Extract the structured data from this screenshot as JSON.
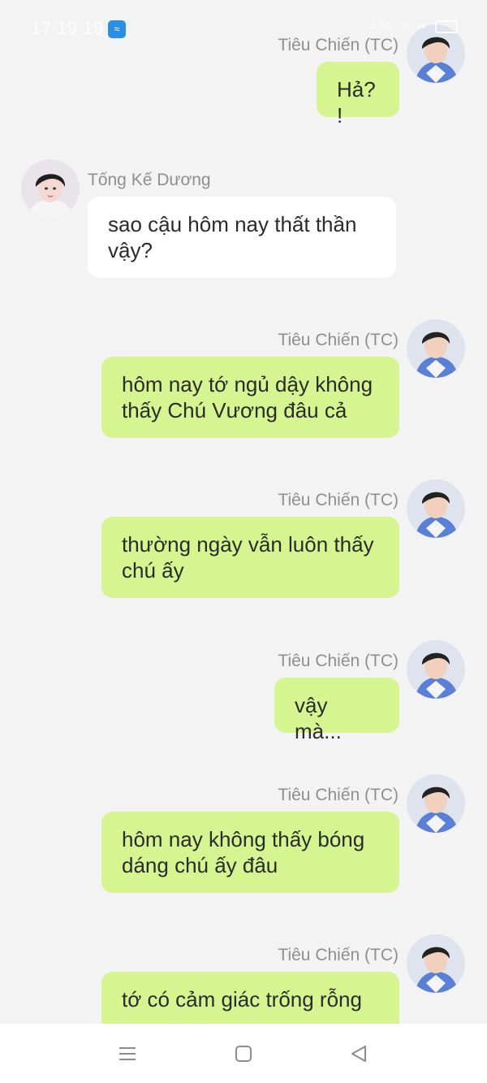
{
  "status_bar": {
    "time": "17:19:19",
    "app_icon": "wifi-hotspot-icon",
    "speed": "4.00",
    "signal": "signal-icon",
    "battery": "battery-icon"
  },
  "colors": {
    "background": "#f3f3f3",
    "outgoing_bubble": "#d4f58f",
    "incoming_bubble": "#ffffff",
    "name_text": "#8f8f8f",
    "message_text": "#2b2b2b"
  },
  "messages": [
    {
      "side": "right",
      "sender": "Tiêu Chiến (TC)",
      "text": "Hả?!"
    },
    {
      "side": "left",
      "sender": "Tống Kế Dương",
      "text": "sao cậu hôm nay thất thần vậy?"
    },
    {
      "side": "right",
      "sender": "Tiêu Chiến (TC)",
      "text": "hôm nay tớ ngủ dậy không thấy Chú Vương đâu cả"
    },
    {
      "side": "right",
      "sender": "Tiêu Chiến (TC)",
      "text": "thường ngày vẫn luôn thấy chú ấy"
    },
    {
      "side": "right",
      "sender": "Tiêu Chiến (TC)",
      "text": "vậy mà..."
    },
    {
      "side": "right",
      "sender": "Tiêu Chiến (TC)",
      "text": "hôm nay không thấy bóng dáng chú ấy đâu"
    },
    {
      "side": "right",
      "sender": "Tiêu Chiến (TC)",
      "text": "tớ có cảm giác trống rỗng"
    }
  ],
  "nav_bar": {
    "menu": "menu-icon",
    "home": "home-icon",
    "back": "back-icon"
  }
}
